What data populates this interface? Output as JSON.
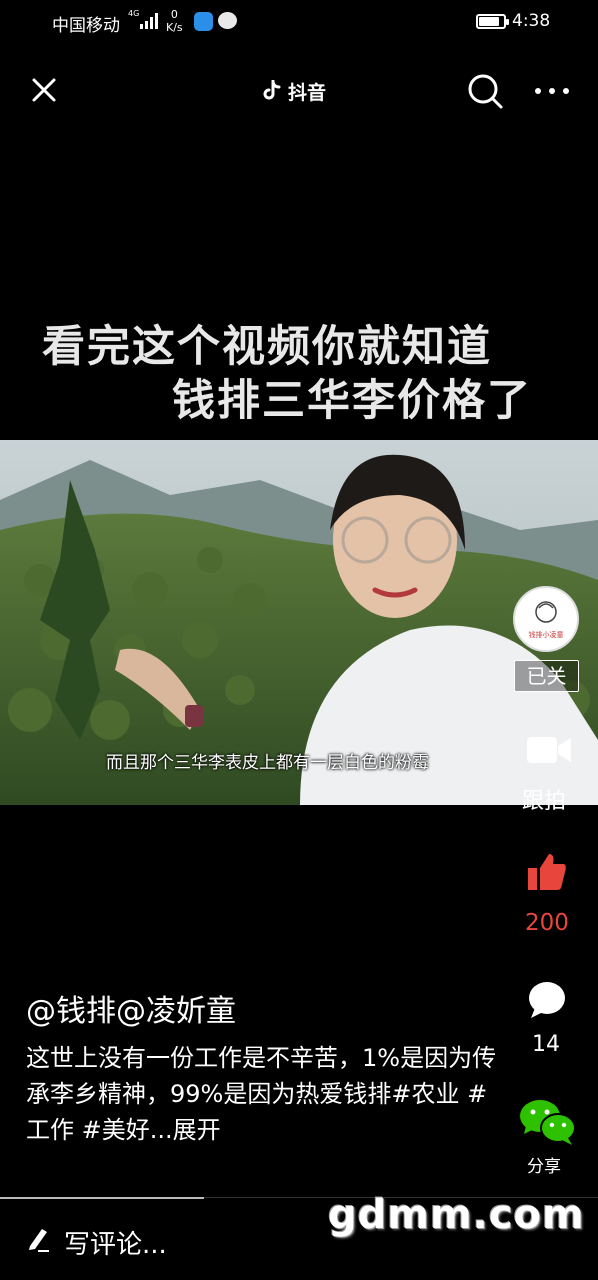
{
  "status_bar": {
    "carrier": "中国移动",
    "network": "4G",
    "speed_value": "0",
    "speed_unit": "K/s",
    "battery_level": 0.85,
    "time": "4:38"
  },
  "top_bar": {
    "close_icon": "close-icon",
    "brand_name": "抖音",
    "search_icon": "search-icon",
    "more_icon": "more-icon"
  },
  "video": {
    "caption_line1": "看完这个视频你就知道",
    "caption_line2": "钱排三华李价格了",
    "subtitle": "而且那个三华李表皮上都有一层白色的粉霉"
  },
  "actions": {
    "avatar_text": "钱排小凌童",
    "follow_label": "已关",
    "follow_shot_label": "跟拍",
    "like_count": "200",
    "comment_count": "14",
    "share_label": "分享",
    "like_color": "#e8453c",
    "wechat_color": "#2dc100"
  },
  "post": {
    "author": "@钱排@凌妡童",
    "description": "这世上没有一份工作是不辛苦，1%是因为传承李乡精神，99%是因为热爱钱排#农业 #工作 #美好...展开"
  },
  "bottom": {
    "comment_placeholder": "写评论...",
    "watermark": "gdmm.com"
  }
}
